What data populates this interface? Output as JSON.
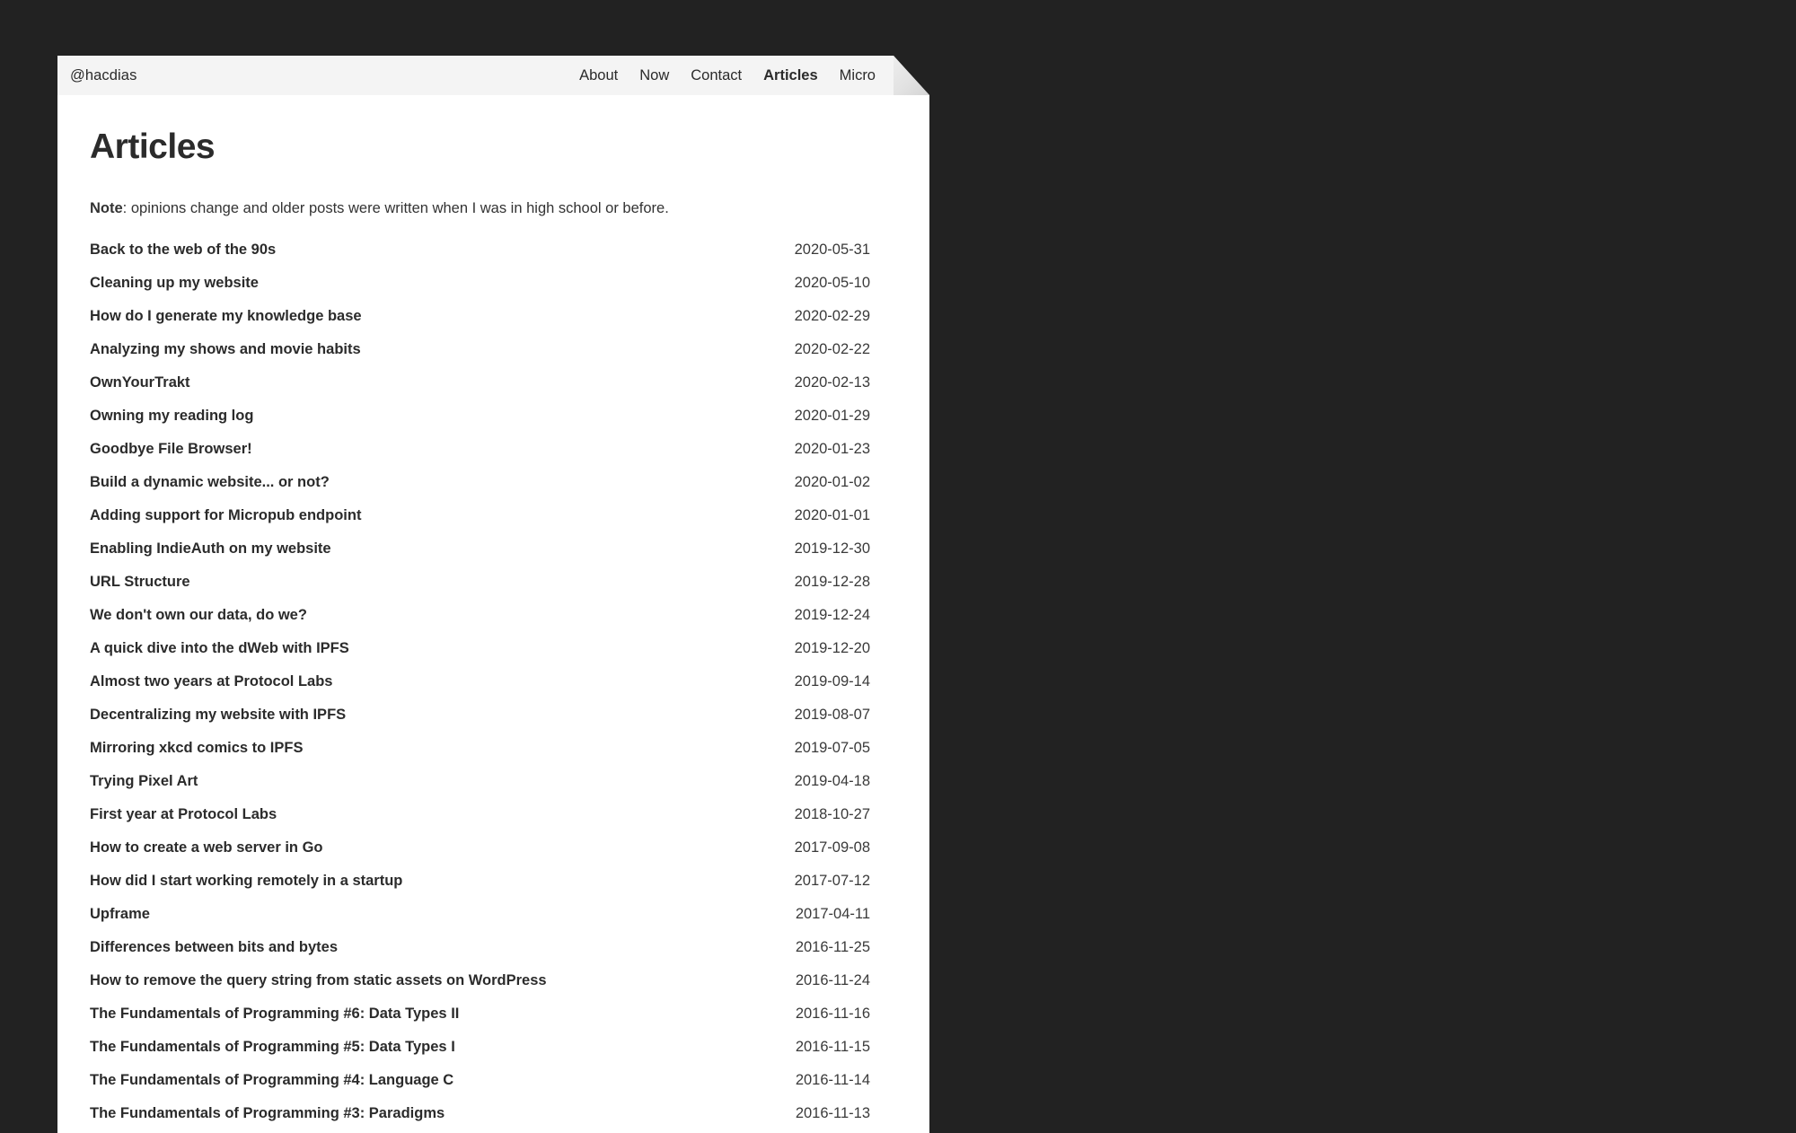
{
  "theme": {
    "background": "#222222",
    "card_background": "#ffffff",
    "navbar_background": "#f4f4f4",
    "text_color": "#2b2b2b"
  },
  "navbar": {
    "brand": "@hacdias",
    "links": [
      {
        "label": "About",
        "active": false
      },
      {
        "label": "Now",
        "active": false
      },
      {
        "label": "Contact",
        "active": false
      },
      {
        "label": "Articles",
        "active": true
      },
      {
        "label": "Micro",
        "active": false
      }
    ]
  },
  "main": {
    "title": "Articles",
    "note_label": "Note",
    "note_text": ": opinions change and older posts were written when I was in high school or before.",
    "articles": [
      {
        "title": "Back to the web of the 90s",
        "date": "2020-05-31"
      },
      {
        "title": "Cleaning up my website",
        "date": "2020-05-10"
      },
      {
        "title": "How do I generate my knowledge base",
        "date": "2020-02-29"
      },
      {
        "title": "Analyzing my shows and movie habits",
        "date": "2020-02-22"
      },
      {
        "title": "OwnYourTrakt",
        "date": "2020-02-13"
      },
      {
        "title": "Owning my reading log",
        "date": "2020-01-29"
      },
      {
        "title": "Goodbye File Browser!",
        "date": "2020-01-23"
      },
      {
        "title": "Build a dynamic website... or not?",
        "date": "2020-01-02"
      },
      {
        "title": "Adding support for Micropub endpoint",
        "date": "2020-01-01"
      },
      {
        "title": "Enabling IndieAuth on my website",
        "date": "2019-12-30"
      },
      {
        "title": "URL Structure",
        "date": "2019-12-28"
      },
      {
        "title": "We don't own our data, do we?",
        "date": "2019-12-24"
      },
      {
        "title": "A quick dive into the dWeb with IPFS",
        "date": "2019-12-20"
      },
      {
        "title": "Almost two years at Protocol Labs",
        "date": "2019-09-14"
      },
      {
        "title": "Decentralizing my website with IPFS",
        "date": "2019-08-07"
      },
      {
        "title": "Mirroring xkcd comics to IPFS",
        "date": "2019-07-05"
      },
      {
        "title": "Trying Pixel Art",
        "date": "2019-04-18"
      },
      {
        "title": "First year at Protocol Labs",
        "date": "2018-10-27"
      },
      {
        "title": "How to create a web server in Go",
        "date": "2017-09-08"
      },
      {
        "title": "How did I start working remotely in a startup",
        "date": "2017-07-12"
      },
      {
        "title": "Upframe",
        "date": "2017-04-11"
      },
      {
        "title": "Differences between bits and bytes",
        "date": "2016-11-25"
      },
      {
        "title": "How to remove the query string from static assets on WordPress",
        "date": "2016-11-24"
      },
      {
        "title": "The Fundamentals of Programming #6: Data Types II",
        "date": "2016-11-16"
      },
      {
        "title": "The Fundamentals of Programming #5: Data Types I",
        "date": "2016-11-15"
      },
      {
        "title": "The Fundamentals of Programming #4: Language C",
        "date": "2016-11-14"
      },
      {
        "title": "The Fundamentals of Programming #3: Paradigms",
        "date": "2016-11-13"
      }
    ]
  }
}
